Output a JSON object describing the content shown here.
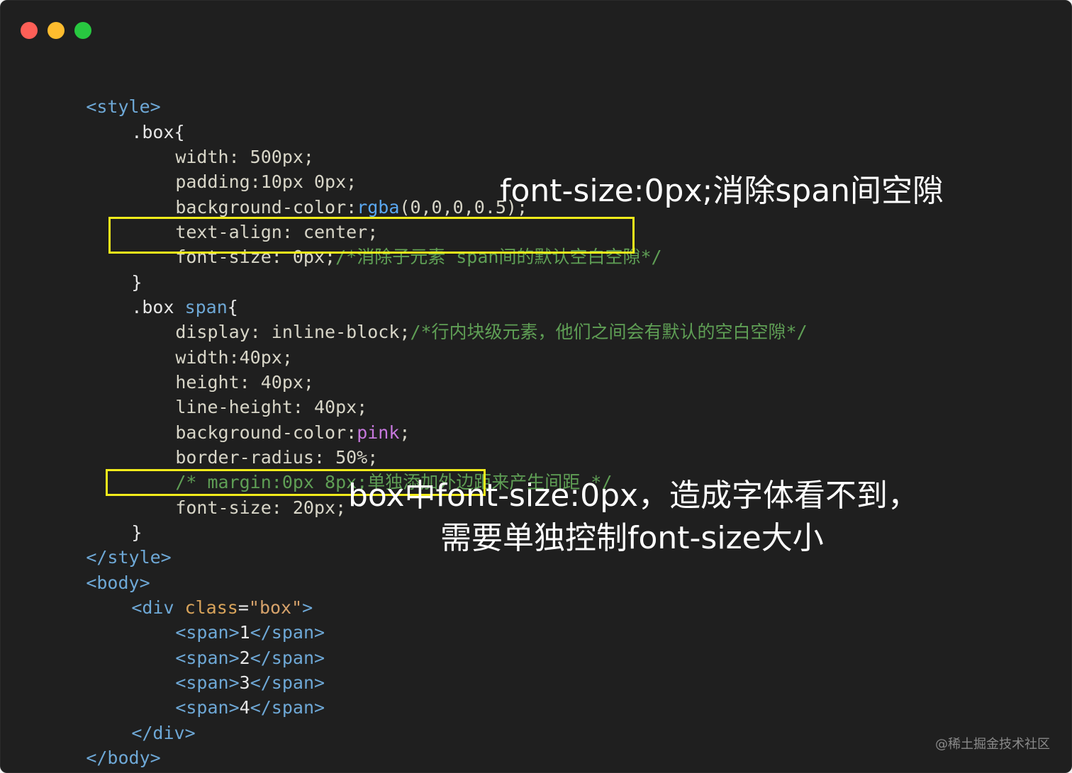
{
  "colors": {
    "background": "#1f1f1f",
    "highlight_border": "#f2ec1b",
    "dot_close": "#fe5f57",
    "dot_minimize": "#febc2e",
    "dot_zoom": "#28c840"
  },
  "window_controls": [
    "close",
    "minimize",
    "zoom"
  ],
  "code": {
    "l1": "<style>",
    "l2_sel": ".box",
    "l2_brace": "{",
    "l3_prop": "width: ",
    "l3_val": "500px;",
    "l4_prop": "padding:",
    "l4_val": "10px 0px;",
    "l5_prop": "background-color:",
    "l5_fn": "rgba",
    "l5_val": "(0,0,0,0.5);",
    "l6": "text-align: center;",
    "l7_prop": "font-size: 0px;",
    "l7_comment": "/*消除子元素 span间的默认空白空隙*/",
    "l8": "}",
    "l9_sel": ".box ",
    "l9_span": "span",
    "l9_brace": "{",
    "l10_prop": "display: inline-block;",
    "l10_comment": "/*行内块级元素，他们之间会有默认的空白空隙*/",
    "l11": "width:40px;",
    "l12": "height: 40px;",
    "l13": "line-height: 40px;",
    "l14_prop": "background-color:",
    "l14_val": "pink",
    "l14_end": ";",
    "l15": "border-radius: 50%;",
    "l16_comment": "/* margin:0px 8px;单独添加外边距来产生间距 */",
    "l17": "font-size: 20px;",
    "l18": "}",
    "l19": "</style>",
    "l20": "<body>",
    "l21_open": "<div ",
    "l21_attr": "class",
    "l21_eq": "=",
    "l21_str": "\"box\"",
    "l21_close": ">",
    "spans": [
      {
        "open": "<span>",
        "text": "1",
        "close": "</span>"
      },
      {
        "open": "<span>",
        "text": "2",
        "close": "</span>"
      },
      {
        "open": "<span>",
        "text": "3",
        "close": "</span>"
      },
      {
        "open": "<span>",
        "text": "4",
        "close": "</span>"
      }
    ],
    "l26": "</div>",
    "l27": "</body>"
  },
  "annotations": {
    "top": "font-size:0px;消除span间空隙",
    "bottom_1": "box中font-size:0px，造成字体看不到，",
    "bottom_2": "需要单独控制font-size大小"
  },
  "watermark": "@稀土掘金技术社区"
}
